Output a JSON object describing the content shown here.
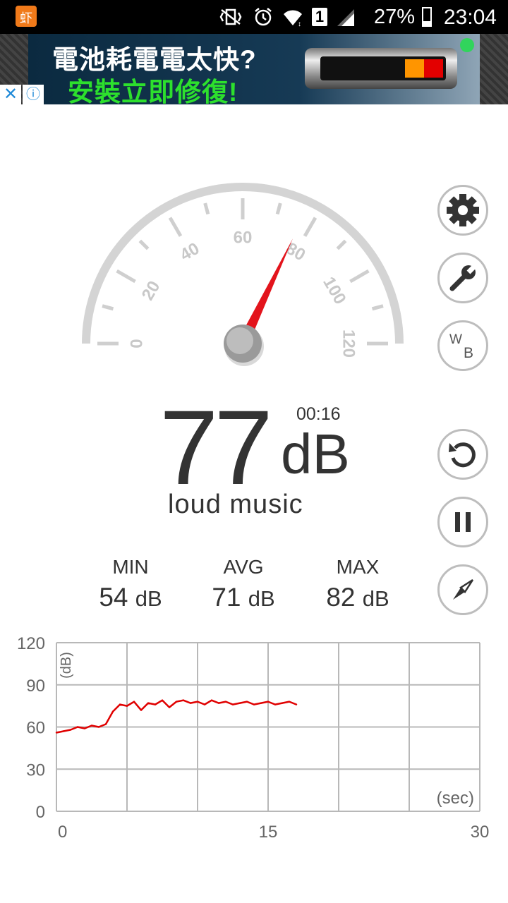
{
  "status_bar": {
    "app_icon_char": "虾",
    "sim_slot": "1",
    "battery_percent": "27%",
    "time": "23:04"
  },
  "ad": {
    "line1": "電池耗電電太快?",
    "line2": "安裝立即修復!",
    "close_glyph": "✕",
    "info_glyph": "ⓘ"
  },
  "gauge": {
    "min": 0,
    "max": 120,
    "tick_labels": [
      "0",
      "20",
      "40",
      "60",
      "80",
      "100",
      "120"
    ],
    "needle_value": 77
  },
  "reading": {
    "value": "77",
    "unit": "dB",
    "elapsed": "00:16",
    "description": "loud music"
  },
  "stats": [
    {
      "label": "MIN",
      "value": "54",
      "unit": "dB"
    },
    {
      "label": "AVG",
      "value": "71",
      "unit": "dB"
    },
    {
      "label": "MAX",
      "value": "82",
      "unit": "dB"
    }
  ],
  "side_buttons": [
    {
      "name": "settings",
      "icon": "gear-icon"
    },
    {
      "name": "calibrate",
      "icon": "wrench-icon"
    },
    {
      "name": "weighting",
      "icon": "wb-icon",
      "text_top": "W",
      "text_bottom": "B"
    },
    {
      "name": "reset",
      "icon": "reset-icon"
    },
    {
      "name": "pause",
      "icon": "pause-icon"
    },
    {
      "name": "compass",
      "icon": "compass-icon"
    }
  ],
  "chart_data": {
    "type": "line",
    "ylabel": "(dB)",
    "xlabel": "(sec)",
    "xlim": [
      0,
      30
    ],
    "ylim": [
      0,
      120
    ],
    "x_ticks": [
      0,
      15,
      30
    ],
    "y_ticks": [
      0,
      30,
      60,
      90,
      120
    ],
    "grid": true,
    "color": "#e00000",
    "series": [
      {
        "x": [
          0,
          0.5,
          1.0,
          1.5,
          2.0,
          2.5,
          3.0,
          3.5,
          4.0,
          4.5,
          5.0,
          5.5,
          6.0,
          6.5,
          7.0,
          7.5,
          8.0,
          8.5,
          9.0,
          9.5,
          10.0,
          10.5,
          11.0,
          11.5,
          12.0,
          12.5,
          13.0,
          13.5,
          14.0,
          14.5,
          15.0,
          15.5,
          16.0,
          16.5,
          17.0
        ],
        "y": [
          56,
          57,
          58,
          60,
          59,
          61,
          60,
          62,
          71,
          76,
          75,
          78,
          72,
          77,
          76,
          79,
          74,
          78,
          79,
          77,
          78,
          76,
          79,
          77,
          78,
          76,
          77,
          78,
          76,
          77,
          78,
          76,
          77,
          78,
          76
        ]
      }
    ]
  }
}
